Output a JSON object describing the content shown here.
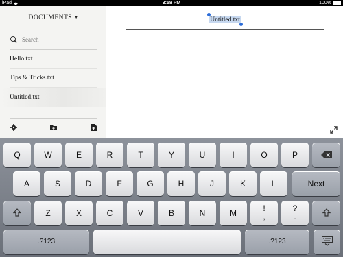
{
  "status_bar": {
    "carrier": "iPad",
    "wifi_icon": "wifi-icon",
    "time": "3:58 PM",
    "battery_text": "100%",
    "battery_level": 1.0
  },
  "sidebar": {
    "title": "DOCUMENTS",
    "search_placeholder": "Search",
    "files": [
      {
        "name": "Hello.txt"
      },
      {
        "name": "Tips & Tricks.txt"
      },
      {
        "name": "Untitled.txt"
      }
    ],
    "selected_file": "Untitled.txt",
    "toolbar_icons": [
      "gear-icon",
      "new-folder-icon",
      "new-document-icon"
    ]
  },
  "editor": {
    "title": "Untitled.txt",
    "fullscreen_icon": "expand-icon"
  },
  "keyboard": {
    "row1": [
      "Q",
      "W",
      "E",
      "R",
      "T",
      "Y",
      "U",
      "I",
      "O",
      "P"
    ],
    "row2": [
      "A",
      "S",
      "D",
      "F",
      "G",
      "H",
      "J",
      "K",
      "L"
    ],
    "return_label": "Next",
    "row3": [
      "Z",
      "X",
      "C",
      "V",
      "B",
      "N",
      "M"
    ],
    "punct1": [
      "!",
      ","
    ],
    "punct2": [
      "?",
      "."
    ],
    "numbers_label": ".?123",
    "backspace_icon": "backspace-icon",
    "shift_icon": "shift-icon",
    "hide_keyboard_icon": "hide-keyboard-icon"
  }
}
